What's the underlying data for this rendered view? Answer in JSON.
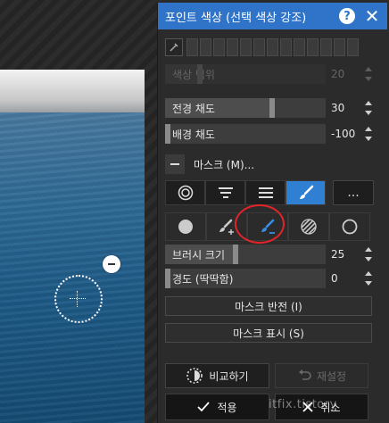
{
  "panel": {
    "title": "포인트 색상 (선택 색상 강조)",
    "icons": {
      "help": "help-icon",
      "close": "close-icon",
      "picker": "eyedropper-icon"
    },
    "accent_color": "#2f74c8"
  },
  "sliders": {
    "range": {
      "label": "색상 범위",
      "value": "20",
      "enabled": false,
      "level": 0.2
    },
    "foreground_saturation": {
      "label": "전경 채도",
      "value": "30",
      "level": 0.65
    },
    "background_saturation": {
      "label": "배경 채도",
      "value": "-100",
      "level": 0.0
    },
    "brush_size": {
      "label": "브러시 크기",
      "value": "25",
      "level": 0.42
    },
    "hardness": {
      "label": "경도 (딱딱함)",
      "value": "0",
      "level": 0.0
    }
  },
  "mask": {
    "label": "마스크 (M)..."
  },
  "mode_buttons": [
    {
      "icon": "radial-mask-icon",
      "active": false
    },
    {
      "icon": "gradient-mask-icon",
      "active": false
    },
    {
      "icon": "linear-mask-icon",
      "active": false
    },
    {
      "icon": "brush-mask-icon",
      "active": true
    }
  ],
  "more_label": "...",
  "tools": [
    {
      "icon": "fill-dot-icon"
    },
    {
      "icon": "brush-add-icon"
    },
    {
      "icon": "brush-erase-icon"
    },
    {
      "icon": "hatch-icon"
    },
    {
      "icon": "circle-outline-icon"
    }
  ],
  "buttons": {
    "invert_mask": "마스크 반전 (I)",
    "show_mask": "마스크 표시 (S)",
    "compare": "비교하기",
    "reset": "재설정",
    "apply": "적용",
    "cancel": "취소"
  },
  "watermark": "itfix.tistory"
}
